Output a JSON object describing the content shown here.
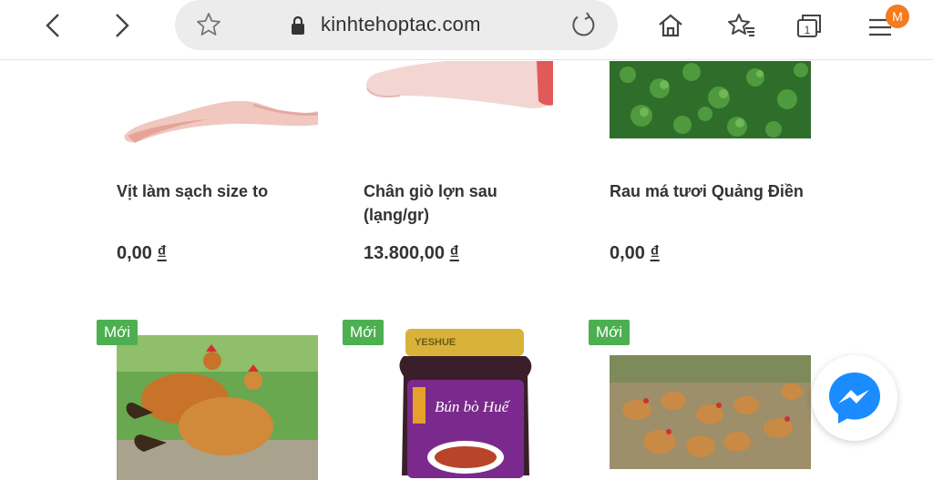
{
  "browser": {
    "url": "kinhtehoptac.com",
    "profile_initial": "M"
  },
  "products_row1": [
    {
      "name": "Vịt làm sạch size to",
      "price": "0,00",
      "currency": "₫"
    },
    {
      "name": "Chân giò lợn sau (lạng/gr)",
      "price": "13.800,00",
      "currency": "₫"
    },
    {
      "name": "Rau má tươi Quảng Điền",
      "price": "0,00",
      "currency": "₫"
    }
  ],
  "products_row2": [
    {
      "badge": "Mới"
    },
    {
      "badge": "Mới",
      "jar_brand": "YESHUE",
      "jar_title": "Bún bò Huế"
    },
    {
      "badge": "Mới"
    }
  ],
  "colors": {
    "badge": "#4caf50",
    "messenger": "#1a8cff",
    "profile_badge": "#f47b20"
  }
}
